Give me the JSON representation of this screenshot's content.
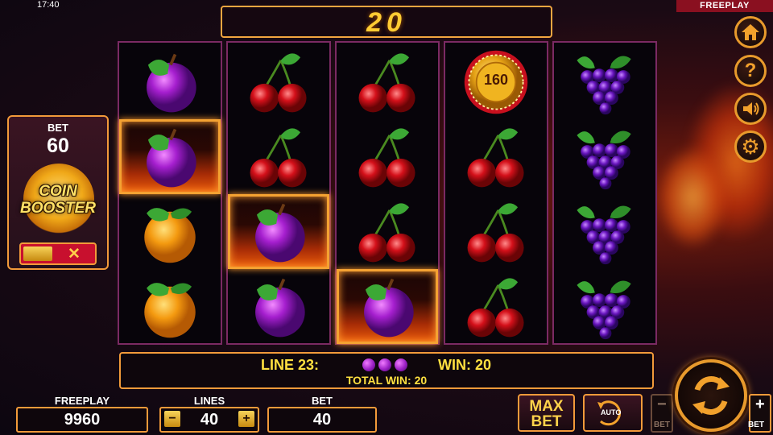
{
  "status": {
    "clock": "17:40",
    "mode_tag": "FREEPLAY"
  },
  "top_win": "20",
  "reels": [
    [
      "plum",
      "plum-win",
      "orange",
      "orange"
    ],
    [
      "cherry",
      "cherry",
      "plum-win",
      "plum"
    ],
    [
      "cherry",
      "cherry",
      "cherry",
      "plum-win"
    ],
    [
      "coin",
      "cherry",
      "cherry",
      "cherry"
    ],
    [
      "grapes",
      "grapes",
      "grapes",
      "grapes"
    ]
  ],
  "coin_symbol_value": "160",
  "booster": {
    "bet_label": "BET",
    "bet_value": "60",
    "title_line1": "COIN",
    "title_line2": "BOOSTER",
    "toggle_icon": "close-x-icon"
  },
  "side_buttons": [
    "home-icon",
    "help-icon",
    "sound-icon",
    "settings-icon"
  ],
  "win_info": {
    "line_text": "LINE 23:",
    "win_text": "WIN: 20",
    "total_text": "TOTAL WIN: 20",
    "symbols": [
      "plum",
      "plum",
      "plum"
    ]
  },
  "bottom": {
    "freeplay_label": "FREEPLAY",
    "freeplay_value": "9960",
    "lines_label": "LINES",
    "lines_value": "40",
    "lines_minus": "−",
    "lines_plus": "+",
    "bet_label": "BET",
    "bet_value": "40",
    "max_bet_line1": "MAX",
    "max_bet_line2": "BET",
    "auto_label": "AUTO",
    "bet_minus_label": "BET",
    "bet_plus_label": "BET",
    "bet_minus_sign": "−",
    "bet_plus_sign": "+"
  },
  "colors": {
    "accent": "#f29a3a",
    "gold": "#ffe040",
    "reel_border": "#7b2a63",
    "toggle_red": "#c8102e"
  }
}
